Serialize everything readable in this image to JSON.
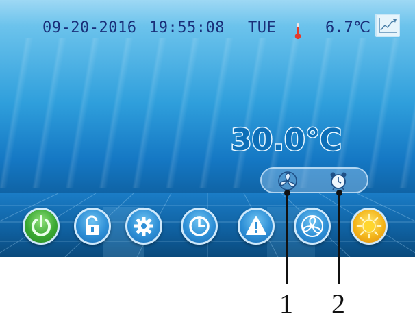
{
  "status_bar": {
    "date": "09-20-2016",
    "time": "19:55:08",
    "weekday": "TUE",
    "outdoor_temp": "6.7℃",
    "thermometer_icon": "thermometer-icon",
    "chart_icon": "trend-chart-icon"
  },
  "display": {
    "setpoint_temp": "30.0℃",
    "status_icons": [
      "fan-status-icon",
      "alarm-clock-status-icon"
    ]
  },
  "toolbar": {
    "buttons": [
      {
        "name": "power-button",
        "icon": "power-icon",
        "color": "#3aa832"
      },
      {
        "name": "unlock-button",
        "icon": "unlock-icon",
        "color": "#2e8fd6"
      },
      {
        "name": "settings-button",
        "icon": "gear-icon",
        "color": "#2e8fd6"
      },
      {
        "name": "timer-button",
        "icon": "clock-icon",
        "color": "#2e8fd6"
      },
      {
        "name": "alarm-button",
        "icon": "warning-icon",
        "color": "#2e8fd6"
      },
      {
        "name": "fan-button",
        "icon": "fan-icon",
        "color": "#2e8fd6"
      },
      {
        "name": "mode-button",
        "icon": "sun-icon",
        "color": "#f3b51a"
      }
    ]
  },
  "callouts": {
    "label_1": "1",
    "label_2": "2"
  }
}
